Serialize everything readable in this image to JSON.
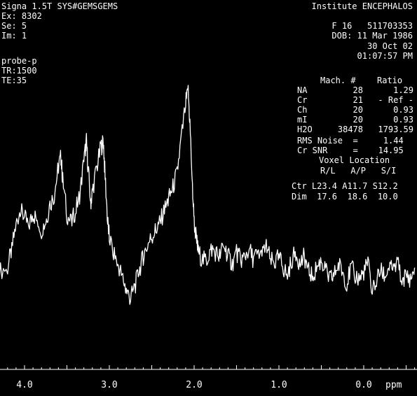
{
  "header_left": {
    "line1": "Signa 1.5T SYS#GEMSGEMS",
    "line2": "Ex: 8302",
    "line3": "Se: 5",
    "line4": "Im: 1",
    "probe": "probe-p",
    "tr": "TR:1500",
    "te": "TE:35"
  },
  "header_right": {
    "institute": "Institute ENCEPHALOS",
    "patient": "F 16   511703353",
    "dob": "DOB: 11 Mar 1986",
    "date": "30 Oct 02",
    "time": "01:07:57 PM"
  },
  "table": {
    "headers": [
      "",
      "Mach. #",
      "Ratio"
    ],
    "rows": [
      {
        "name": "NA",
        "mach": "28",
        "ratio": "1.29"
      },
      {
        "name": "Cr",
        "mach": "21",
        "ratio": "- Ref -"
      },
      {
        "name": "Ch",
        "mach": "20",
        "ratio": "0.93"
      },
      {
        "name": "mI",
        "mach": "20",
        "ratio": "0.93"
      },
      {
        "name": "H2O",
        "mach": "38478",
        "ratio": "1793.59"
      }
    ],
    "rms_noise": "RMS Noise  =     1.44",
    "cr_snr": "Cr SNR     =    14.95",
    "voxel_title": "Voxel Location",
    "voxel_headers": "R/L   A/P   S/I",
    "ctr": "Ctr L23.4 A11.7 S12.2",
    "dim": "Dim  17.6  18.6  10.0"
  },
  "chart_data": {
    "type": "line",
    "xlabel": "ppm",
    "xlim": [
      4.3,
      -0.6
    ],
    "x_reversed": true,
    "ylim": [
      0,
      130
    ],
    "x_ticks": [
      "4.0",
      "3.0",
      "2.0",
      "1.0",
      "0.0"
    ],
    "series": [
      {
        "x": [
          4.3,
          4.2,
          4.15,
          4.1,
          4.05,
          4.0,
          3.95,
          3.9,
          3.85,
          3.8,
          3.75,
          3.7,
          3.65,
          3.6,
          3.57,
          3.55,
          3.5,
          3.45,
          3.4,
          3.35,
          3.3,
          3.27,
          3.25,
          3.22,
          3.2,
          3.15,
          3.1,
          3.07,
          3.05,
          3.02,
          3.0,
          2.95,
          2.9,
          2.85,
          2.8,
          2.75,
          2.7,
          2.65,
          2.6,
          2.55,
          2.5,
          2.45,
          2.4,
          2.35,
          2.3,
          2.25,
          2.2,
          2.15,
          2.1,
          2.07,
          2.05,
          2.02,
          2.0,
          1.97,
          1.95,
          1.9,
          1.85,
          1.8,
          1.75,
          1.7,
          1.65,
          1.6,
          1.55,
          1.5,
          1.45,
          1.4,
          1.35,
          1.3,
          1.25,
          1.2,
          1.15,
          1.1,
          1.05,
          1.0,
          0.95,
          0.9,
          0.85,
          0.8,
          0.75,
          0.7,
          0.65,
          0.6,
          0.55,
          0.5,
          0.45,
          0.4,
          0.35,
          0.3,
          0.25,
          0.2,
          0.15,
          0.1,
          0.05,
          0.0,
          -0.05,
          -0.1,
          -0.15,
          -0.2,
          -0.25,
          -0.3,
          -0.35,
          -0.4,
          -0.45,
          -0.5,
          -0.55,
          -0.6
        ],
        "y": [
          30,
          32,
          42,
          55,
          62,
          58,
          54,
          60,
          57,
          52,
          56,
          65,
          70,
          85,
          90,
          78,
          60,
          55,
          62,
          70,
          88,
          98,
          84,
          66,
          72,
          84,
          95,
          98,
          80,
          56,
          48,
          40,
          34,
          28,
          20,
          16,
          22,
          30,
          38,
          44,
          48,
          52,
          56,
          62,
          68,
          74,
          82,
          100,
          118,
          124,
          108,
          74,
          56,
          46,
          40,
          36,
          36,
          42,
          40,
          38,
          44,
          38,
          34,
          40,
          36,
          38,
          42,
          36,
          40,
          38,
          44,
          36,
          34,
          38,
          32,
          28,
          36,
          40,
          34,
          38,
          30,
          28,
          32,
          36,
          30,
          26,
          28,
          34,
          30,
          24,
          32,
          28,
          26,
          30,
          34,
          20,
          26,
          30,
          28,
          32,
          30,
          34,
          26,
          28,
          26,
          32
        ]
      }
    ]
  }
}
